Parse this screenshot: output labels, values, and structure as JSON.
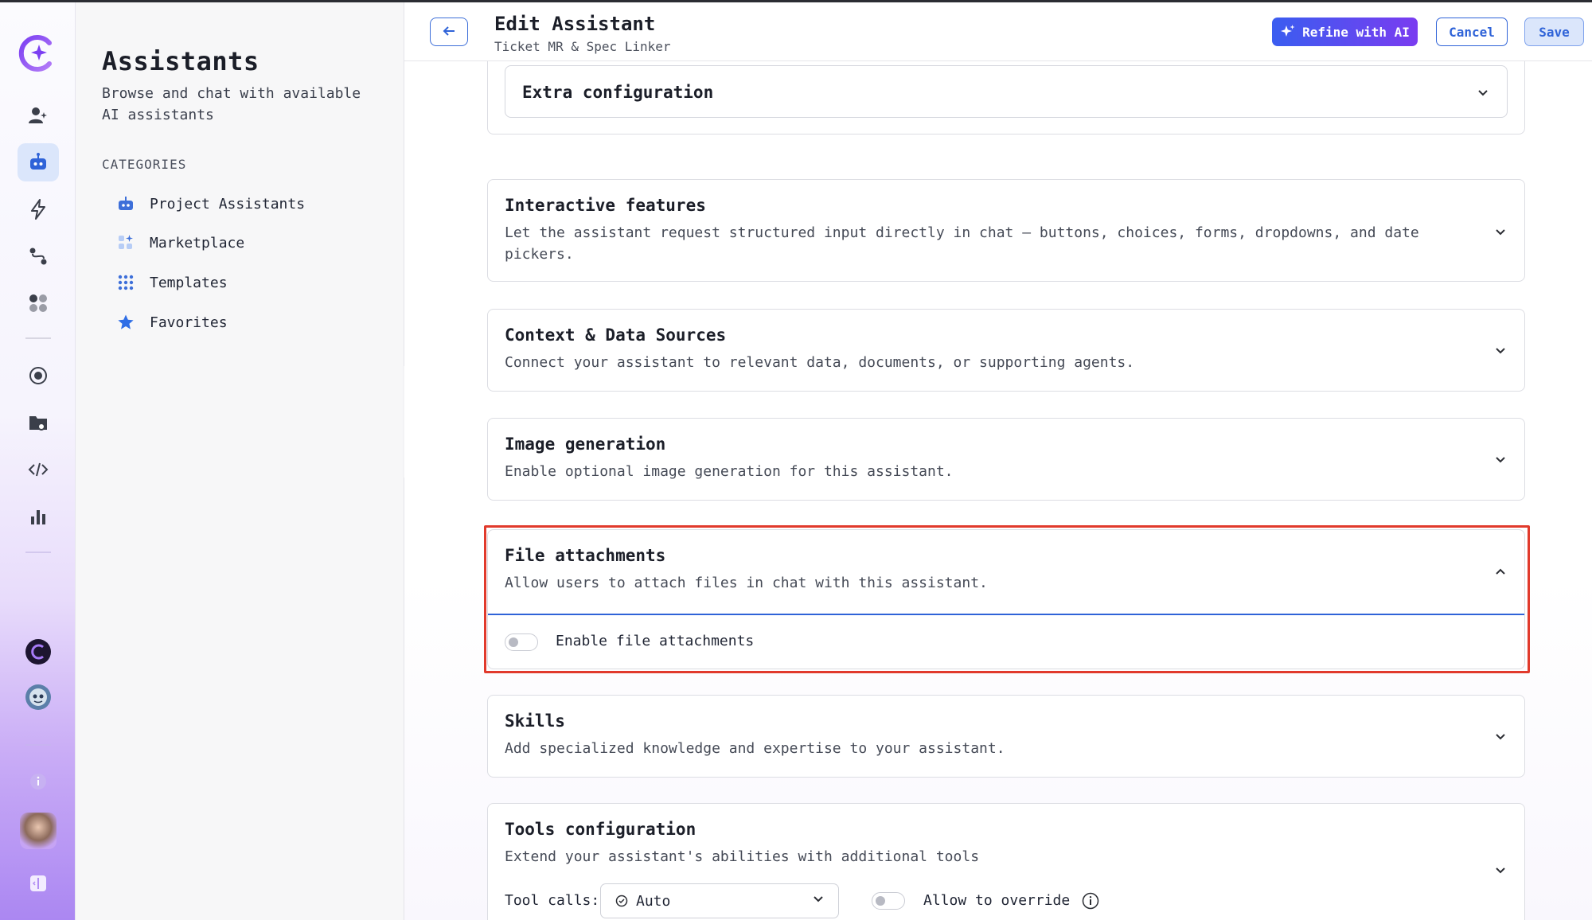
{
  "sidebar": {
    "title": "Assistants",
    "description": "Browse and chat with available AI assistants",
    "categories_heading": "CATEGORIES",
    "items": [
      {
        "label": "Project Assistants",
        "icon": "robot-icon"
      },
      {
        "label": "Marketplace",
        "icon": "sparkle-grid-icon"
      },
      {
        "label": "Templates",
        "icon": "grid-icon"
      },
      {
        "label": "Favorites",
        "icon": "star-icon"
      }
    ]
  },
  "header": {
    "title": "Edit Assistant",
    "subtitle": "Ticket MR & Spec Linker",
    "refine_label": "Refine with AI",
    "cancel_label": "Cancel",
    "save_label": "Save"
  },
  "sections": {
    "extra": {
      "title": "Extra configuration"
    },
    "interactive": {
      "title": "Interactive features",
      "description": "Let the assistant request structured input directly in chat — buttons, choices, forms, dropdowns, and date pickers."
    },
    "context": {
      "title": "Context & Data Sources",
      "description": "Connect your assistant to relevant data, documents, or supporting agents."
    },
    "image": {
      "title": "Image generation",
      "description": "Enable optional image generation for this assistant."
    },
    "files": {
      "title": "File attachments",
      "description": "Allow users to attach files in chat with this assistant.",
      "toggle_label": "Enable file attachments",
      "enabled": false
    },
    "skills": {
      "title": "Skills",
      "description": "Add specialized knowledge and expertise to your assistant."
    },
    "tools": {
      "title": "Tools configuration",
      "description": "Extend your assistant's abilities with additional tools",
      "tool_calls_label": "Tool calls:",
      "tool_calls_value": "Auto",
      "override_label": "Allow to override",
      "override_enabled": false
    }
  },
  "colors": {
    "accent": "#2f63d8",
    "highlight": "#e13a2c",
    "refine_start": "#3a5df0",
    "refine_end": "#7a3cf0"
  }
}
